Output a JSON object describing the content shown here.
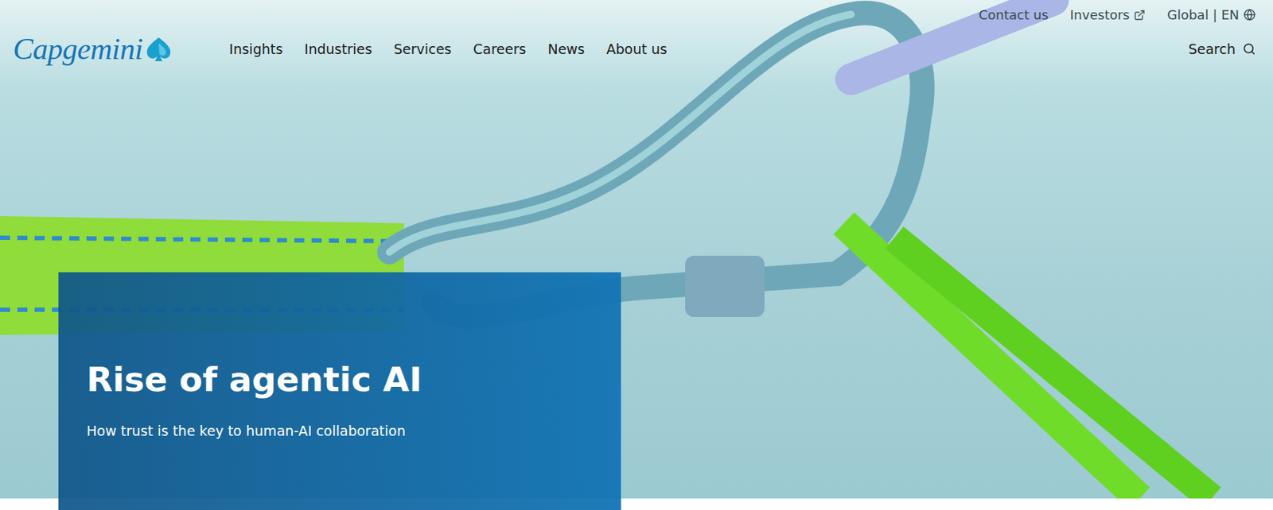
{
  "header": {
    "logo": "Capgemini",
    "nav": [
      {
        "label": "Insights"
      },
      {
        "label": "Industries"
      },
      {
        "label": "Services"
      },
      {
        "label": "Careers"
      },
      {
        "label": "News"
      },
      {
        "label": "About us"
      }
    ],
    "utility": [
      {
        "label": "Contact us",
        "kind": "plain"
      },
      {
        "label": "Investors",
        "kind": "external"
      },
      {
        "label": "Global | EN",
        "kind": "globe"
      }
    ],
    "search": {
      "label": "Search"
    }
  },
  "hero": {
    "title": "Rise of agentic AI",
    "subtitle": "How trust is the key to human-AI collaboration"
  }
}
